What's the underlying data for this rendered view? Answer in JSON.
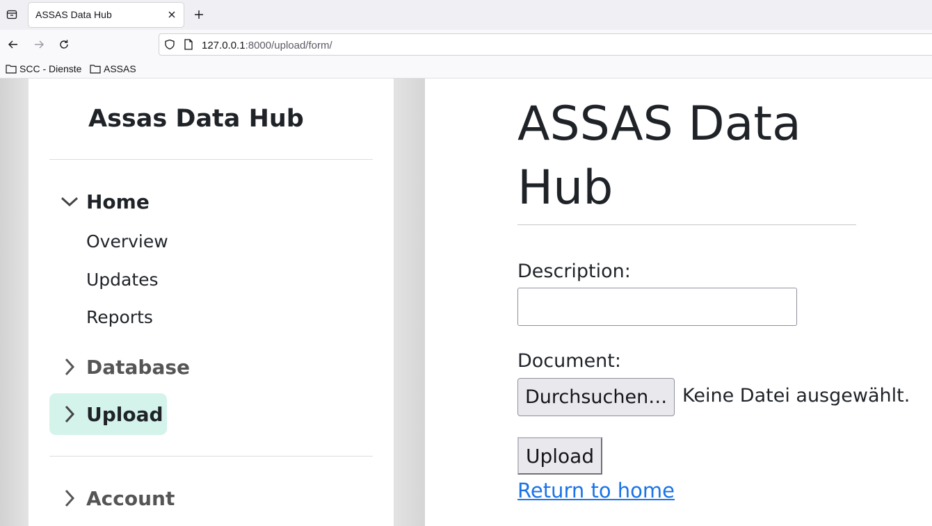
{
  "browser": {
    "tab_title": "ASSAS Data Hub",
    "url_host": "127.0.0.1",
    "url_rest": ":8000/upload/form/",
    "bookmarks": [
      "SCC - Dienste",
      "ASSAS"
    ]
  },
  "sidebar": {
    "brand": "Assas Data Hub",
    "home": {
      "label": "Home",
      "expanded": true,
      "items": [
        "Overview",
        "Updates",
        "Reports"
      ]
    },
    "database": {
      "label": "Database",
      "expanded": false
    },
    "upload": {
      "label": "Upload",
      "active": true,
      "active_color": "#d4f3eb"
    },
    "account": {
      "label": "Account",
      "expanded": false
    }
  },
  "main": {
    "title": "ASSAS Data Hub",
    "description_label": "Description:",
    "description_value": "",
    "document_label": "Document:",
    "browse_button": "Durchsuchen…",
    "file_status": "Keine Datei ausgewählt.",
    "upload_button": "Upload",
    "return_link": "Return to home",
    "link_color": "#1a73e8"
  }
}
